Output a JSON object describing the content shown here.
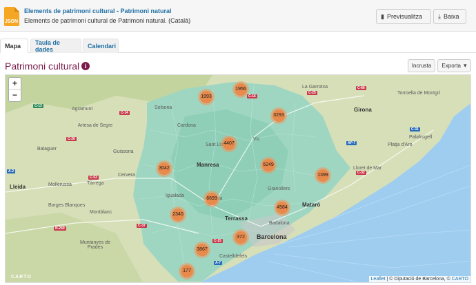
{
  "resource": {
    "format_icon": "JSON",
    "title": "Elements de patrimoni cultural - Patrimoni natural",
    "subtitle": "Elements de patrimoni cultural de Patrimoni natural.   (Català)",
    "preview_label": "Previsualitza",
    "download_label": "Baixa"
  },
  "tabs": [
    {
      "label": "Mapa",
      "active": true
    },
    {
      "label": "Taula de dades",
      "active": false
    },
    {
      "label": "Calendari",
      "active": false
    }
  ],
  "map_section": {
    "title": "Patrimoni cultural",
    "embed_label": "Incrusta",
    "export_label": "Exporta"
  },
  "map": {
    "zoom_in": "+",
    "zoom_out": "−",
    "logo": "CARTO",
    "attribution_leaflet": "Leaflet",
    "attribution_text": " | © Diputació de Barcelona, © ",
    "attribution_carto": "CARTO",
    "clusters": [
      {
        "count": "1956"
      },
      {
        "count": "1993"
      },
      {
        "count": "3293"
      },
      {
        "count": "4407"
      },
      {
        "count": "5249"
      },
      {
        "count": "3042"
      },
      {
        "count": "1399"
      },
      {
        "count": "6699"
      },
      {
        "count": "4584"
      },
      {
        "count": "2340"
      },
      {
        "count": "372"
      },
      {
        "count": "3867"
      },
      {
        "count": "177"
      }
    ],
    "places": [
      {
        "name": "Girona"
      },
      {
        "name": "La Garrotxa"
      },
      {
        "name": "Torroella de Montgrí"
      },
      {
        "name": "Palafrugell"
      },
      {
        "name": "Platja d'Aro"
      },
      {
        "name": "Lloret de Mar"
      },
      {
        "name": "Manresa"
      },
      {
        "name": "Terrassa"
      },
      {
        "name": "Granollers"
      },
      {
        "name": "Mataró"
      },
      {
        "name": "Badalona"
      },
      {
        "name": "Barcelona"
      },
      {
        "name": "Igualada"
      },
      {
        "name": "Solsona"
      },
      {
        "name": "Artesa de Segre"
      },
      {
        "name": "Balaguer"
      },
      {
        "name": "Guissona"
      },
      {
        "name": "Lleida"
      },
      {
        "name": "Mollerussa"
      },
      {
        "name": "Tàrrega"
      },
      {
        "name": "Cervera"
      },
      {
        "name": "Borges Blanques"
      },
      {
        "name": "Montblanc"
      },
      {
        "name": "Muntanyes de Prades"
      },
      {
        "name": "Castelldefels"
      },
      {
        "name": "Cardona"
      },
      {
        "name": "Vic"
      },
      {
        "name": "Agramunt"
      },
      {
        "name": "Olesa"
      },
      {
        "name": "Sant Llorenç"
      }
    ],
    "roads": [
      {
        "label": "C-13"
      },
      {
        "label": "C-14"
      },
      {
        "label": "C-26"
      },
      {
        "label": "C-66"
      },
      {
        "label": "AP-7"
      },
      {
        "label": "C-31"
      },
      {
        "label": "C-32"
      },
      {
        "label": "C-25"
      },
      {
        "label": "A-2"
      },
      {
        "label": "C-53"
      },
      {
        "label": "N-240"
      },
      {
        "label": "C-37"
      },
      {
        "label": "C-16"
      },
      {
        "label": "A-7"
      },
      {
        "label": "C-15"
      }
    ]
  }
}
